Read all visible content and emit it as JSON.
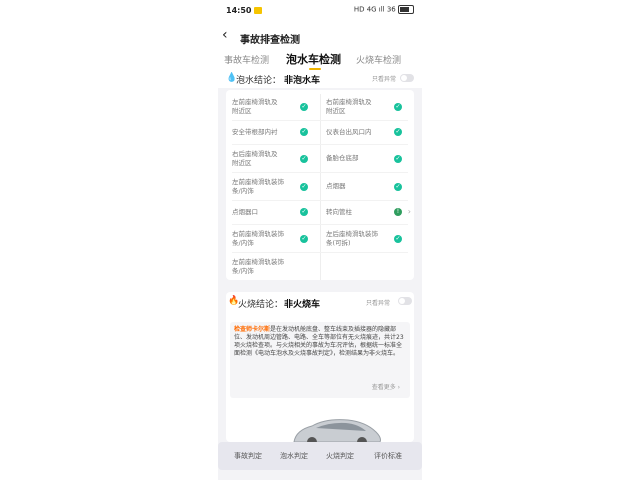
{
  "status_bar": {
    "time": "14:50",
    "right_text": "HD 4G ıll 36"
  },
  "nav": {
    "title": "事故排查检测"
  },
  "tabs": [
    {
      "label": "事故车检测",
      "active": false
    },
    {
      "label": "泡水车检测",
      "active": true
    },
    {
      "label": "火烧车检测",
      "active": false
    }
  ],
  "flood_summary": {
    "label": "泡水结论：",
    "value": "非泡水车",
    "toggle_label": "只看异常"
  },
  "flood_items": [
    {
      "text": "左前座椅滑轨及\n附近区",
      "status": "ok"
    },
    {
      "text": "右前座椅滑轨及\n附近区",
      "status": "ok"
    },
    {
      "text": "安全带根部内衬",
      "status": "ok"
    },
    {
      "text": "仪表台出风口内",
      "status": "ok"
    },
    {
      "text": "右后座椅滑轨及\n附近区",
      "status": "ok"
    },
    {
      "text": "备胎仓底部",
      "status": "ok"
    },
    {
      "text": "左前座椅滑轨装饰\n条/内饰",
      "status": "ok"
    },
    {
      "text": "点烟器口",
      "status": "ok"
    },
    {
      "text": "点烟器",
      "status": "ok"
    },
    {
      "text": "转向管柱",
      "status": "warn"
    },
    {
      "text": "右前座椅滑轨装饰\n条/内饰",
      "status": "ok"
    },
    {
      "text": "左后座椅滑轨装饰\n条(可拆)",
      "status": "ok"
    },
    {
      "text": "左前座椅滑轨装饰\n条/内饰",
      "status": "ok"
    }
  ],
  "fire_summary": {
    "label": "火烧结论：",
    "value": "非火烧车",
    "toggle_label": "只看异常"
  },
  "fire_note": {
    "brand": "检查师卡尔斯",
    "body": "是在发动机舱底盘、整车线束及插接器的隐藏部位、发动机周边管路、电路、全车等部位有无火烧痕迹，共计23项火烧检查项。与火烧相关的事故为车况评估，根据统一标准全面检测《电动车泡水及火烧事故判定》，检测结果为非火烧车。",
    "more": "查看更多 ›"
  },
  "bottom_tabs": [
    "事故判定",
    "泡水判定",
    "火烧判定",
    "评价标准"
  ],
  "colors": {
    "accent": "#f0b400",
    "ok": "#18c29c",
    "warn": "#2f9d5e",
    "flood": "#2e80ff",
    "fire": "#ff8a00"
  }
}
